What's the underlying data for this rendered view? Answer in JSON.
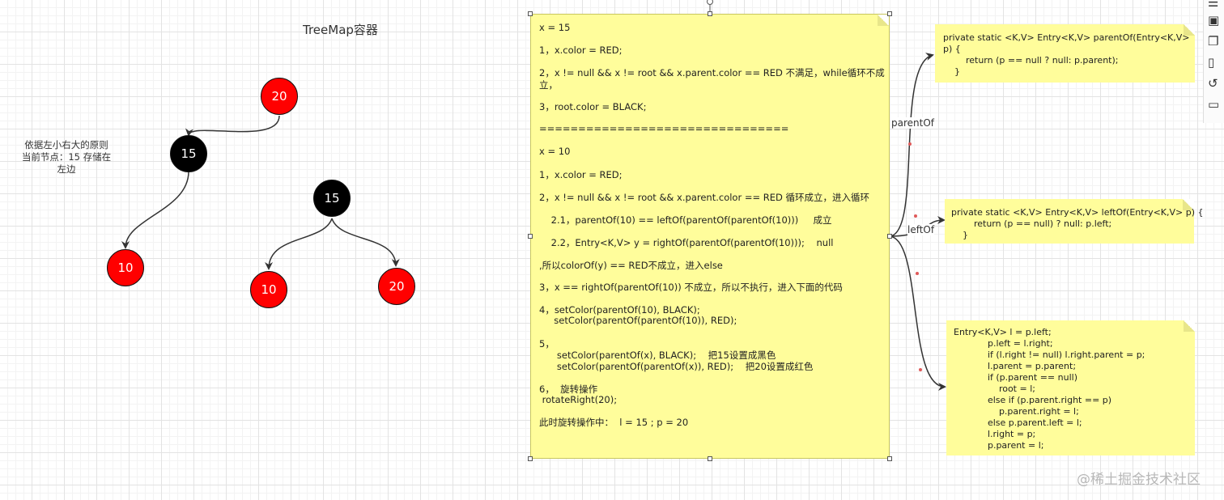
{
  "title": "TreeMap容器",
  "rule_text": [
    "依据左小右大的原则",
    "当前节点：15 存储在",
    "左边"
  ],
  "colors": {
    "red": "#ff0000",
    "black": "#000000",
    "note": "#fffd9b"
  },
  "tree_left": {
    "root": "20",
    "child": "15",
    "grandchild": "10"
  },
  "tree_right": {
    "root": "15",
    "left": "10",
    "right": "20"
  },
  "main_note": [
    "x = 15",
    "1，x.color = RED;",
    "2，x != null && x != root && x.parent.color == RED 不满足，while循环不成",
    "立，",
    "3，root.color = BLACK;",
    "================================",
    "x = 10",
    "1，x.color = RED;",
    "2，x != null && x != root && x.parent.color == RED 循环成立，进入循环",
    "    2.1，parentOf(10) == leftOf(parentOf(parentOf(10)))     成立",
    "    2.2，Entry<K,V> y = rightOf(parentOf(parentOf(10)));    null",
    ",所以colorOf(y) == RED不成立，进入else",
    "3，x == rightOf(parentOf(10)) 不成立，所以不执行，进入下面的代码",
    "4，setColor(parentOf(10), BLACK);",
    "     setColor(parentOf(parentOf(10)), RED);",
    "5，",
    "      setColor(parentOf(x), BLACK);    把15设置成黑色",
    "      setColor(parentOf(parentOf(x)), RED);    把20设置成红色",
    "6，  旋转操作",
    " rotateRight(20);",
    "此时旋转操作中：  l = 15 ; p = 20"
  ],
  "note_parent": [
    "private static <K,V> Entry<K,V> parentOf(Entry<K,V>",
    "p) {",
    "        return (p == null ? null: p.parent);",
    "    }"
  ],
  "note_left": [
    "private static <K,V> Entry<K,V> leftOf(Entry<K,V> p) {",
    "        return (p == null) ? null: p.left;",
    "    }"
  ],
  "note_rotate": [
    "Entry<K,V> l = p.left;",
    "            p.left = l.right;",
    "            if (l.right != null) l.right.parent = p;",
    "            l.parent = p.parent;",
    "            if (p.parent == null)",
    "                root = l;",
    "            else if (p.parent.right == p)",
    "                p.parent.right = l;",
    "            else p.parent.left = l;",
    "            l.right = p;",
    "            p.parent = l;"
  ],
  "edge_labels": {
    "parent": "parentOf",
    "left": "leftOf"
  },
  "watermark": "@稀土掘金技术社区"
}
